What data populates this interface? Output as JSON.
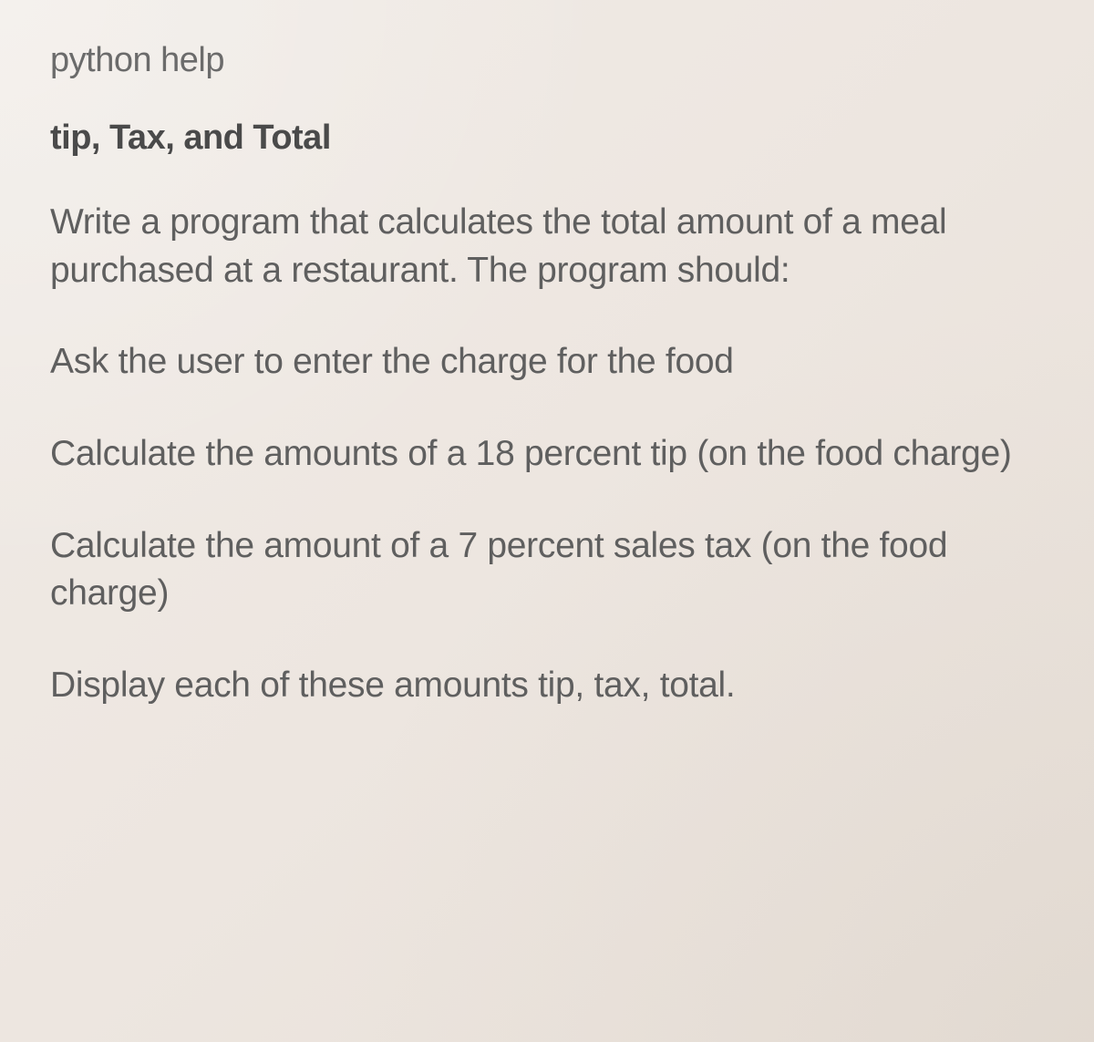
{
  "intro": "python help",
  "title": "tip, Tax, and Total",
  "paragraphs": [
    "Write a program that calculates the total amount of a meal purchased at a restaurant. The program should:",
    "Ask the user to enter the charge for the food",
    "Calculate the amounts of a 18 percent tip (on the food charge)",
    "Calculate the amount of a 7 percent sales tax (on the food charge)",
    "Display each of these amounts tip, tax, total."
  ]
}
